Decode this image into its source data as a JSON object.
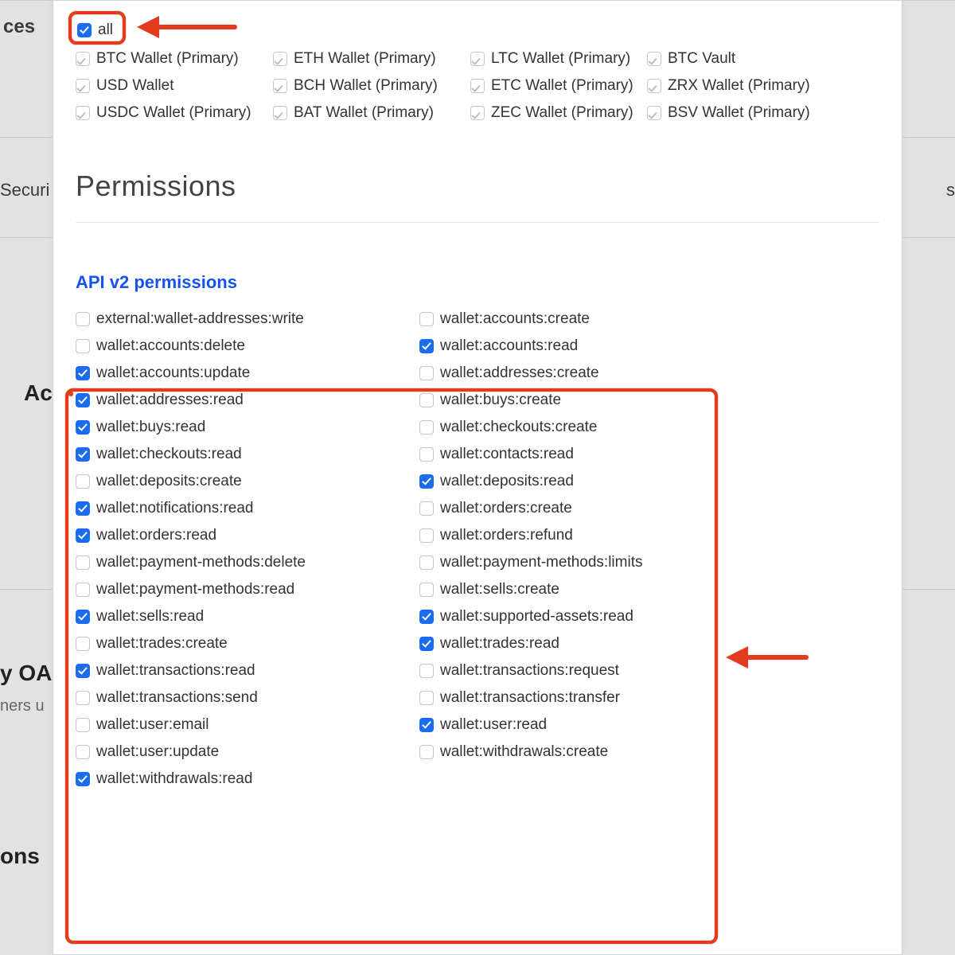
{
  "background": {
    "left1": "ces",
    "left2": "Securi",
    "left3": "Ac",
    "left4": "y OAu",
    "left5": "ners u",
    "left6": "ons",
    "right1": "s"
  },
  "wallets": {
    "all_label": "all",
    "items": [
      "BTC Wallet (Primary)",
      "ETH Wallet (Primary)",
      "LTC Wallet (Primary)",
      "BTC Vault",
      "USD Wallet",
      "BCH Wallet (Primary)",
      "ETC Wallet (Primary)",
      "ZRX Wallet (Primary)",
      "USDC Wallet (Primary)",
      "BAT Wallet (Primary)",
      "ZEC Wallet (Primary)",
      "BSV Wallet (Primary)"
    ]
  },
  "permissions": {
    "heading": "Permissions",
    "subheading": "API v2 permissions",
    "items": [
      {
        "label": "external:wallet-addresses:write",
        "checked": false
      },
      {
        "label": "wallet:accounts:create",
        "checked": false
      },
      {
        "label": "wallet:accounts:delete",
        "checked": false
      },
      {
        "label": "wallet:accounts:read",
        "checked": true
      },
      {
        "label": "wallet:accounts:update",
        "checked": true
      },
      {
        "label": "wallet:addresses:create",
        "checked": false
      },
      {
        "label": "wallet:addresses:read",
        "checked": true
      },
      {
        "label": "wallet:buys:create",
        "checked": false
      },
      {
        "label": "wallet:buys:read",
        "checked": true
      },
      {
        "label": "wallet:checkouts:create",
        "checked": false
      },
      {
        "label": "wallet:checkouts:read",
        "checked": true
      },
      {
        "label": "wallet:contacts:read",
        "checked": false
      },
      {
        "label": "wallet:deposits:create",
        "checked": false
      },
      {
        "label": "wallet:deposits:read",
        "checked": true
      },
      {
        "label": "wallet:notifications:read",
        "checked": true
      },
      {
        "label": "wallet:orders:create",
        "checked": false
      },
      {
        "label": "wallet:orders:read",
        "checked": true
      },
      {
        "label": "wallet:orders:refund",
        "checked": false
      },
      {
        "label": "wallet:payment-methods:delete",
        "checked": false
      },
      {
        "label": "wallet:payment-methods:limits",
        "checked": false
      },
      {
        "label": "wallet:payment-methods:read",
        "checked": false
      },
      {
        "label": "wallet:sells:create",
        "checked": false
      },
      {
        "label": "wallet:sells:read",
        "checked": true
      },
      {
        "label": "wallet:supported-assets:read",
        "checked": true
      },
      {
        "label": "wallet:trades:create",
        "checked": false
      },
      {
        "label": "wallet:trades:read",
        "checked": true
      },
      {
        "label": "wallet:transactions:read",
        "checked": true
      },
      {
        "label": "wallet:transactions:request",
        "checked": false
      },
      {
        "label": "wallet:transactions:send",
        "checked": false
      },
      {
        "label": "wallet:transactions:transfer",
        "checked": false
      },
      {
        "label": "wallet:user:email",
        "checked": false
      },
      {
        "label": "wallet:user:read",
        "checked": true
      },
      {
        "label": "wallet:user:update",
        "checked": false
      },
      {
        "label": "wallet:withdrawals:create",
        "checked": false
      },
      {
        "label": "wallet:withdrawals:read",
        "checked": true
      }
    ]
  }
}
